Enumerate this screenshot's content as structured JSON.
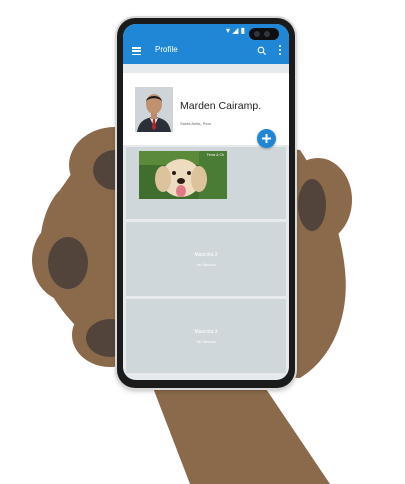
{
  "status_bar": {
    "icons": "▾ ◢ ▮"
  },
  "app_bar": {
    "title": "Profile",
    "menu_icon": "menu-icon",
    "search_icon": "search-icon",
    "more_icon": "more-vert-icon"
  },
  "profile": {
    "name": "Marden Cairamp.",
    "location": "Santa Anita, Peru"
  },
  "fab": {
    "icon": "plus-icon"
  },
  "pets": [
    {
      "name": "",
      "subtitle": "",
      "photo_label": "Fenix & Ch"
    },
    {
      "name": "Mascota 2",
      "subtitle": "Ver Mascota"
    },
    {
      "name": "Mascota 3",
      "subtitle": "Ver Mascota"
    }
  ],
  "colors": {
    "primary": "#1f87d6",
    "card_placeholder": "#cfd7da",
    "screen_bg": "#e6eaec",
    "paw": "#8a6a4a",
    "paw_pad": "#52443b"
  }
}
